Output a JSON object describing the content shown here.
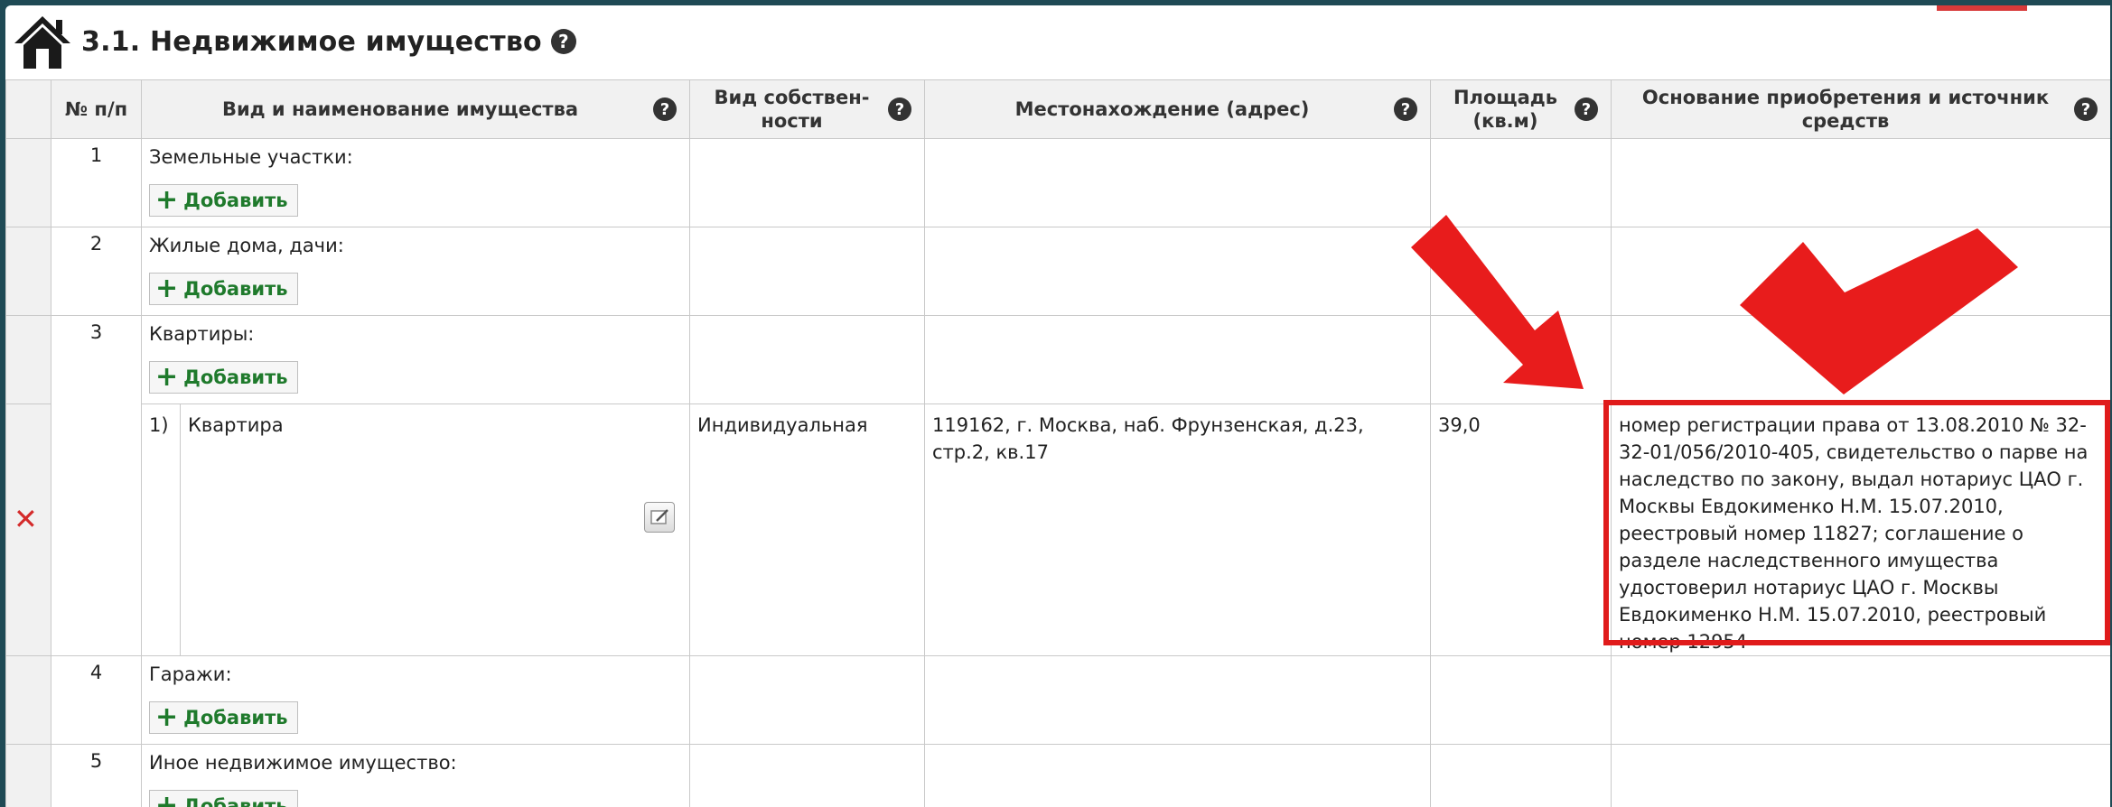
{
  "header": {
    "title": "3.1. Недвижимое имущество",
    "help_symbol": "?"
  },
  "table": {
    "columns": [
      {
        "label": "№ п/п"
      },
      {
        "label": "Вид и наименование имущества"
      },
      {
        "label": "Вид собствен-ности"
      },
      {
        "label": "Местонахождение (адрес)"
      },
      {
        "label": "Площадь (кв.м)"
      },
      {
        "label": "Основание приобретения и источник средств"
      }
    ],
    "add_label": "Добавить",
    "categories": [
      {
        "num": "1",
        "label": "Земельные участки:"
      },
      {
        "num": "2",
        "label": "Жилые дома, дачи:"
      },
      {
        "num": "3",
        "label": "Квартиры:"
      },
      {
        "num": "4",
        "label": "Гаражи:"
      },
      {
        "num": "5",
        "label": "Иное недвижимое имущество:"
      }
    ],
    "item": {
      "num": "1)",
      "name": "Квартира",
      "ownership": "Индивидуальная",
      "address": "119162, г. Москва, наб. Фрунзенская, д.23, стр.2, кв.17",
      "area": "39,0",
      "basis": "номер регистрации права от 13.08.2010 № 32-32-01/056/2010-405, свидетельство о парве на наследство по закону, выдал нотариус ЦАО г. Москвы Евдокименко Н.М. 15.07.2010, реестровый номер 11827; соглашение о разделе наследственного имущества удостоверил нотариус ЦАО г. Москвы Евдокименко Н.М. 15.07.2010, реестровый номер 12954"
    }
  },
  "icons": {
    "home": "house-icon",
    "help": "help-icon",
    "add": "plus-icon",
    "delete": "close-icon",
    "edit": "edit-icon",
    "annotation_arrow": "red-arrow-icon",
    "annotation_check": "red-checkmark-icon"
  },
  "colors": {
    "frame_background": "#1f4a55",
    "add_text": "#1f7a2c",
    "highlight": "#e01b1b",
    "delete": "#d42a2a"
  }
}
